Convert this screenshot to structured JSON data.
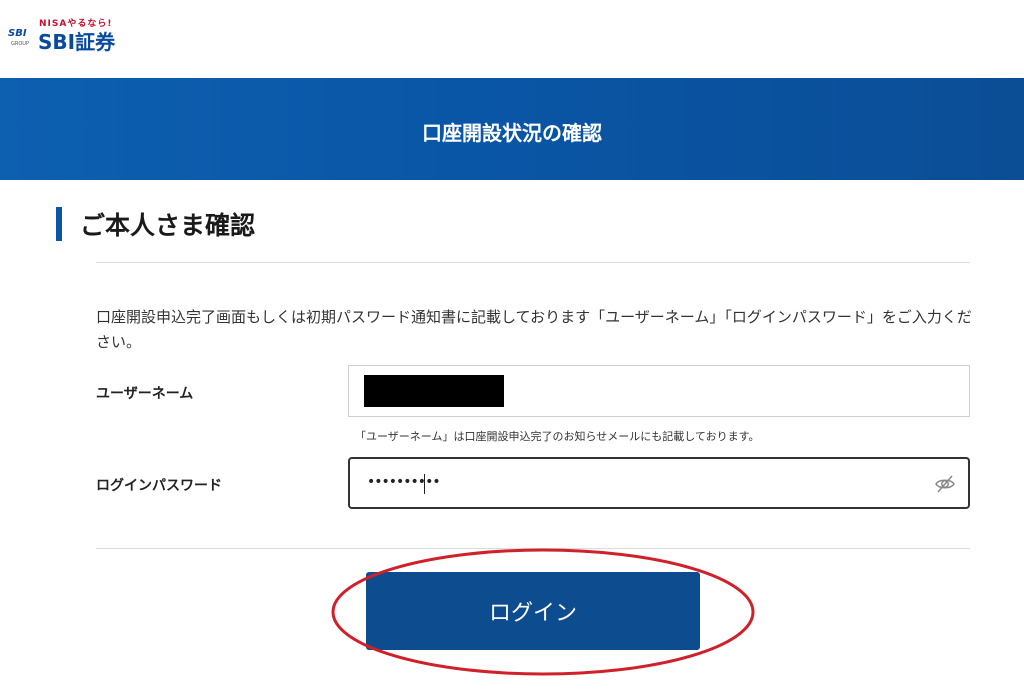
{
  "logo": {
    "tagline": "NISAやるなら!",
    "group_mark": "SBI",
    "group_word": "GROUP",
    "brand": "SBI証券"
  },
  "header": {
    "title": "口座開設状況の確認"
  },
  "section": {
    "heading": "ご本人さま確認"
  },
  "instructions": "口座開設申込完了画面もしくは初期パスワード通知書に記載しております「ユーザーネーム」「ログインパスワード」をご入力ください。",
  "form": {
    "username_label": "ユーザーネーム",
    "username_hint": "「ユーザーネーム」は口座開設申込完了のお知らせメールにも記載しております。",
    "password_label": "ログインパスワード",
    "password_masked": "••••••••••"
  },
  "buttons": {
    "login": "ログイン"
  },
  "colors": {
    "brand_blue": "#0a55a5",
    "button_blue": "#0d4d8f",
    "annotation_red": "#d0202a"
  },
  "icons": {
    "password_visibility": "eye-off-icon"
  }
}
